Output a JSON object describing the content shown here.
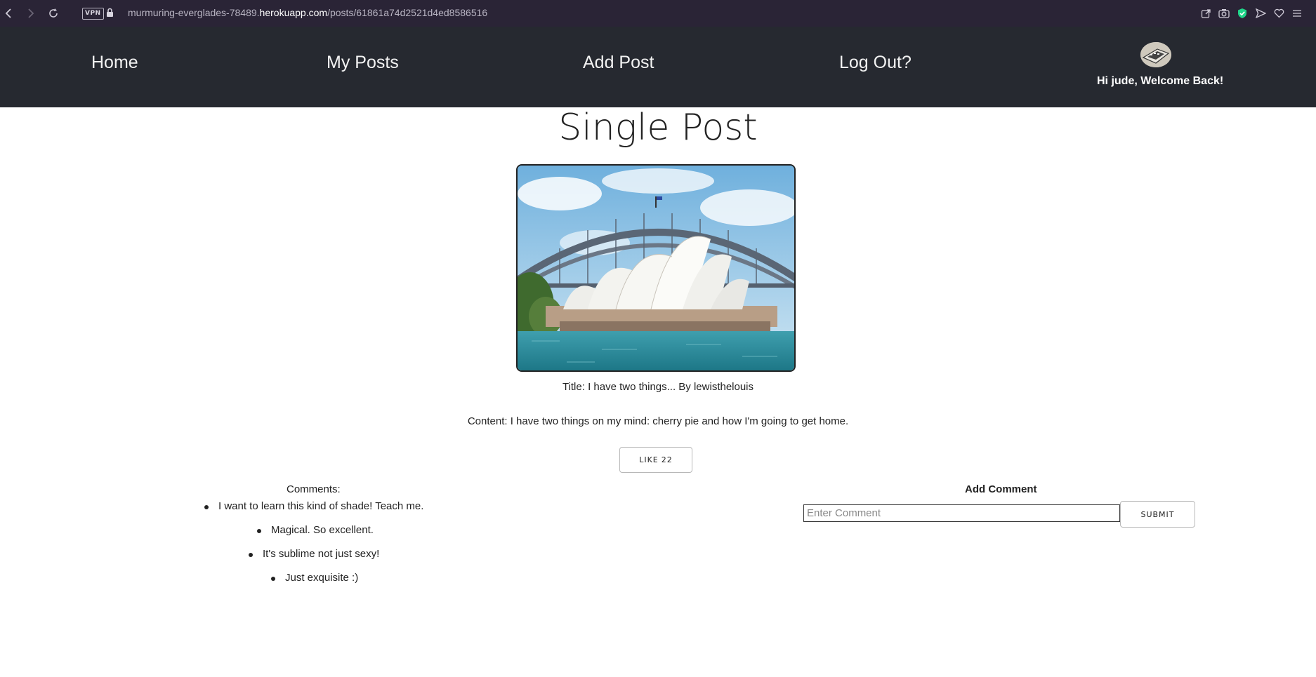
{
  "browser": {
    "vpn_label": "VPN",
    "url_prefix": "murmuring-everglades-78489.",
    "url_host": "herokuapp.com",
    "url_path": "/posts/61861a74d2521d4ed8586516"
  },
  "nav": {
    "home": "Home",
    "my_posts": "My Posts",
    "add_post": "Add Post",
    "log_out": "Log Out?",
    "welcome": "Hi jude, Welcome Back!"
  },
  "page": {
    "title": "Single Post"
  },
  "post": {
    "title_line": "Title: I have two things... By lewisthelouis",
    "content_line": "Content: I have two things on my mind: cherry pie and how I'm going to get home.",
    "image_alt": "Sydney Opera House and Harbour Bridge",
    "like_label": "LIKE",
    "like_count": "22"
  },
  "comments": {
    "heading": "Comments:",
    "items": [
      "I want to learn this kind of shade! Teach me.",
      "Magical. So excellent.",
      "It's sublime not just sexy!",
      "Just exquisite :)"
    ]
  },
  "add_comment": {
    "heading": "Add Comment",
    "placeholder": "Enter Comment",
    "submit_label": "SUBMIT"
  },
  "colors": {
    "browser_bar": "#2a2436",
    "nav_bg": "#262930",
    "accent_shield": "#1fd68a"
  }
}
